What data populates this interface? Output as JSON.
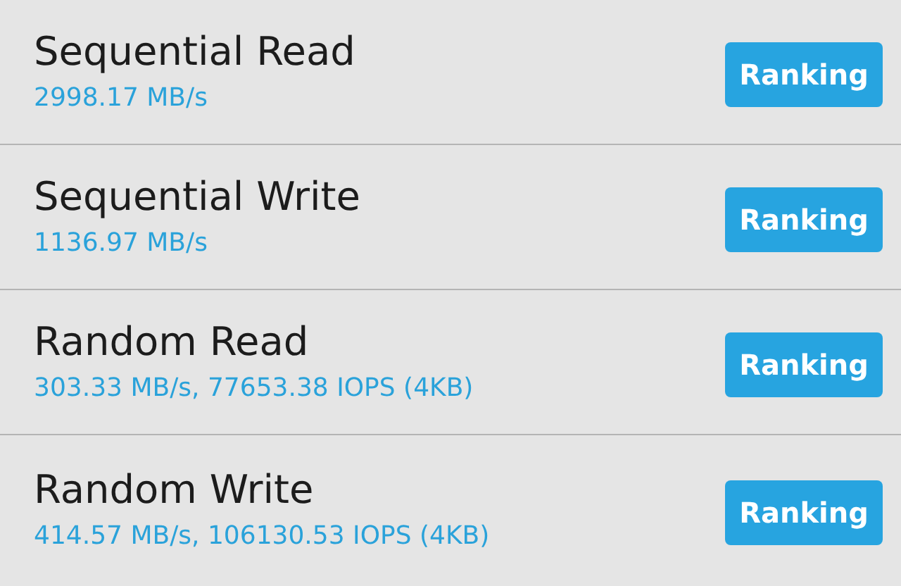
{
  "results": [
    {
      "title": "Sequential Read",
      "value": "2998.17 MB/s",
      "button": "Ranking"
    },
    {
      "title": "Sequential Write",
      "value": "1136.97 MB/s",
      "button": "Ranking"
    },
    {
      "title": "Random Read",
      "value": "303.33 MB/s, 77653.38 IOPS (4KB)",
      "button": "Ranking"
    },
    {
      "title": "Random Write",
      "value": "414.57 MB/s, 106130.53 IOPS (4KB)",
      "button": "Ranking"
    }
  ]
}
